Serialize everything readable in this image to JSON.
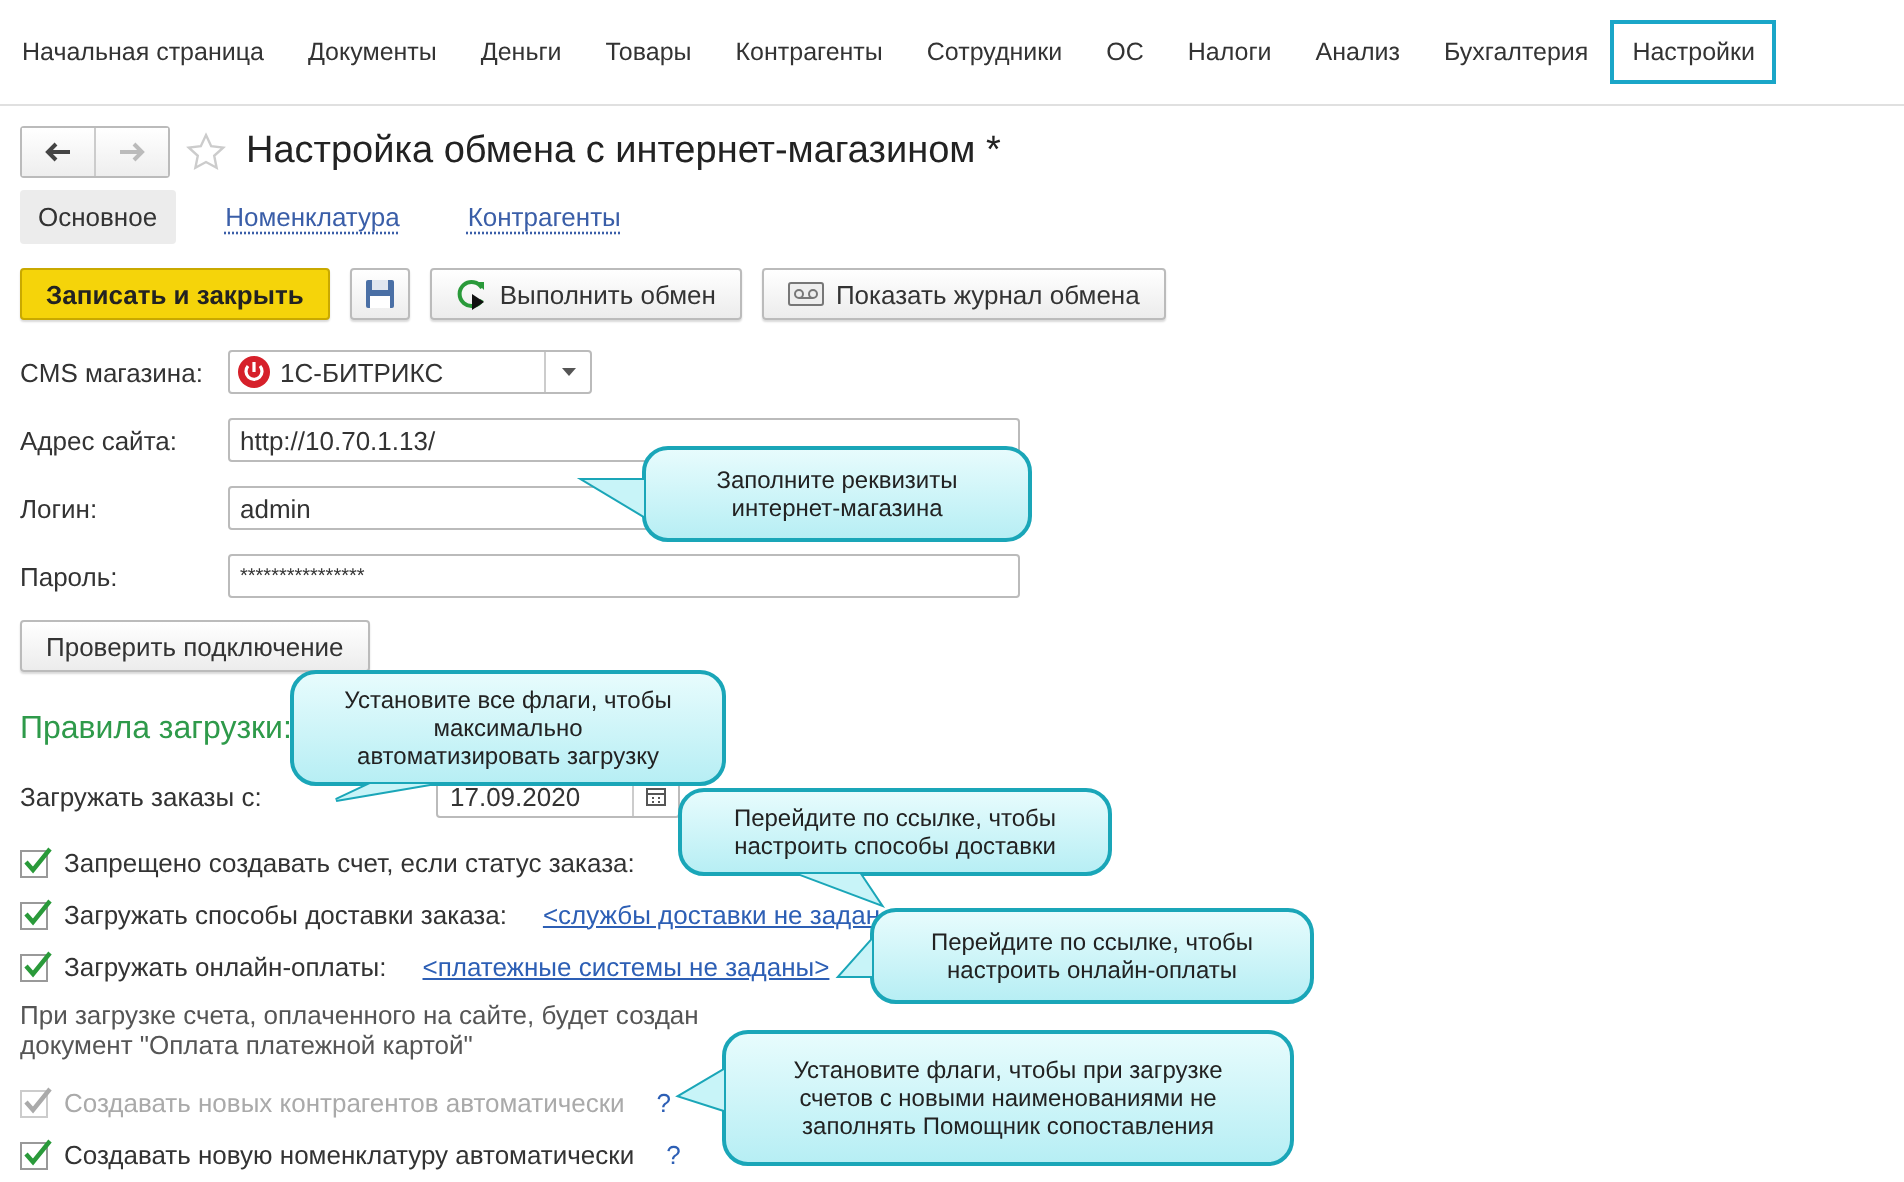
{
  "nav": [
    {
      "label": "Начальная страница",
      "selected": false
    },
    {
      "label": "Документы",
      "selected": false
    },
    {
      "label": "Деньги",
      "selected": false
    },
    {
      "label": "Товары",
      "selected": false
    },
    {
      "label": "Контрагенты",
      "selected": false
    },
    {
      "label": "Сотрудники",
      "selected": false
    },
    {
      "label": "ОС",
      "selected": false
    },
    {
      "label": "Налоги",
      "selected": false
    },
    {
      "label": "Анализ",
      "selected": false
    },
    {
      "label": "Бухгалтерия",
      "selected": false
    },
    {
      "label": "Настройки",
      "selected": true
    }
  ],
  "window": {
    "title": "Настройка обмена с интернет-магазином *"
  },
  "tabs": [
    {
      "label": "Основное",
      "selected": true
    },
    {
      "label": "Номенклатура",
      "selected": false
    },
    {
      "label": "Контрагенты",
      "selected": false
    }
  ],
  "toolbar": {
    "primary": "Записать и закрыть",
    "run": "Выполнить обмен",
    "log": "Показать журнал обмена"
  },
  "form": {
    "cms": {
      "label": "CMS магазина:",
      "value": "1С-БИТРИКС"
    },
    "fields": [
      {
        "label": "Адрес сайта:",
        "value": "http://10.70.1.13/"
      },
      {
        "label": "Логин:",
        "value": "admin"
      },
      {
        "label": "Пароль:",
        "value": "****************"
      }
    ],
    "check_button": "Проверить подключение",
    "section_title": "Правила загрузки:",
    "date": {
      "label": "Загружать заказы с:",
      "value": "17.09.2020"
    },
    "options": [
      {
        "label": "Запрещено создавать счет, если статус заказа:",
        "checked": true,
        "disabled": false
      },
      {
        "label": "Загружать способы доставки заказа:",
        "checked": true,
        "disabled": false,
        "link": "<службы доставки не задан"
      },
      {
        "label": "Загружать онлайн-оплаты:",
        "checked": true,
        "disabled": false,
        "link": "<платежные системы не заданы>"
      }
    ],
    "note": "При загрузке счета, оплаченного на сайте, будет создан документ \"Оплата платежной картой\"",
    "auto_options": [
      {
        "label": "Создавать новых контрагентов автоматически",
        "checked": true,
        "disabled": true,
        "help": "?"
      },
      {
        "label": "Создавать новую номенклатуру автоматически",
        "checked": true,
        "disabled": false,
        "help": "?"
      }
    ]
  },
  "callouts": [
    "Заполните реквизиты интернет-магазина",
    "Установите все флаги, чтобы максимально автоматизировать загрузку",
    "Перейдите по ссылке, чтобы настроить способы доставки",
    "Перейдите по ссылке, чтобы настроить онлайн-оплаты",
    "Установите флаги, чтобы при загрузке счетов с новыми наименованиями не заполнять Помощник сопоставления"
  ]
}
